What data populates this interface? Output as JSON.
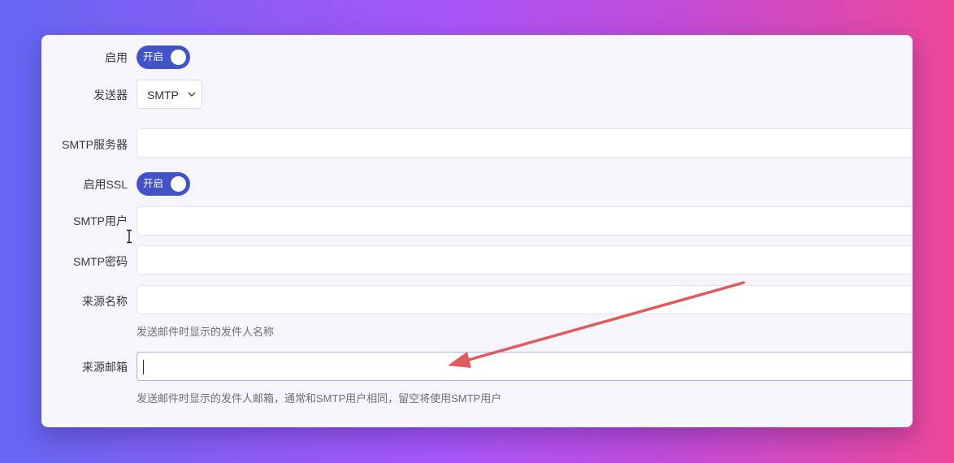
{
  "form": {
    "enable": {
      "label": "启用",
      "toggle_text": "开启"
    },
    "sender": {
      "label": "发送器",
      "value": "SMTP"
    },
    "smtp_server": {
      "label": "SMTP服务器",
      "value": ""
    },
    "enable_ssl": {
      "label": "启用SSL",
      "toggle_text": "开启"
    },
    "smtp_user": {
      "label": "SMTP用户",
      "value": ""
    },
    "smtp_password": {
      "label": "SMTP密码",
      "value": ""
    },
    "from_name": {
      "label": "来源名称",
      "value": "",
      "help": "发送邮件时显示的发件人名称"
    },
    "from_email": {
      "label": "来源邮箱",
      "value": "",
      "help": "发送邮件时显示的发件人邮箱，通常和SMTP用户相同，留空将使用SMTP用户"
    }
  },
  "colors": {
    "toggle_on": "#4353c7",
    "annotation_arrow": "#e05a5e"
  },
  "icons": [
    "chevron-down-icon",
    "text-cursor-icon",
    "annotation-arrow"
  ]
}
